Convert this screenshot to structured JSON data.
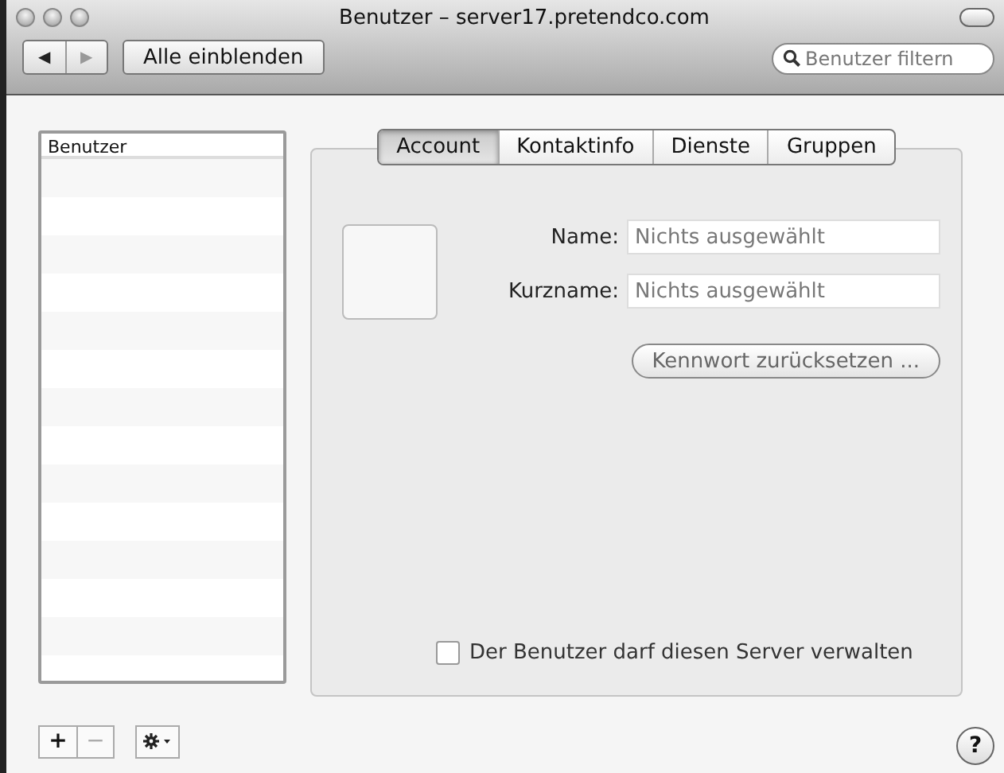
{
  "window": {
    "title": "Benutzer – server17.pretendco.com"
  },
  "toolbar": {
    "nav": [
      {
        "symbol": "◀",
        "disabled": false
      },
      {
        "symbol": "▶",
        "disabled": true
      }
    ],
    "show_all": "Alle einblenden",
    "search": {
      "placeholder": "Benutzer filtern"
    }
  },
  "user_list": {
    "header": "Benutzer"
  },
  "tabs": [
    {
      "label": "Account",
      "selected": true
    },
    {
      "label": "Kontaktinfo",
      "selected": false
    },
    {
      "label": "Dienste",
      "selected": false
    },
    {
      "label": "Gruppen",
      "selected": false
    }
  ],
  "fields": [
    {
      "label": "Name:",
      "placeholder": "Nichts ausgewählt"
    },
    {
      "label": "Kurzname:",
      "placeholder": "Nichts ausgewählt"
    }
  ],
  "reset_button": {
    "label": "Kennwort zurücksetzen ...",
    "disabled": true
  },
  "admin_checkbox": {
    "label": "Der Benutzer darf diesen Server verwalten",
    "checked": false
  },
  "bottom_buttons": [
    {
      "symbol": "+",
      "disabled": false
    },
    {
      "symbol": "−",
      "disabled": true
    }
  ],
  "help": "?"
}
